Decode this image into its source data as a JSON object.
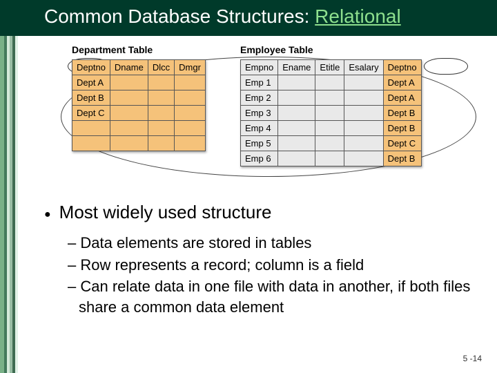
{
  "title": {
    "prefix": "Common Database Structures: ",
    "highlight": "Relational"
  },
  "diagram": {
    "dept": {
      "label": "Department Table",
      "headers": [
        "Deptno",
        "Dname",
        "Dlcc",
        "Dmgr"
      ],
      "rows": [
        [
          "Dept A",
          "",
          "",
          ""
        ],
        [
          "Dept B",
          "",
          "",
          ""
        ],
        [
          "Dept C",
          "",
          "",
          ""
        ],
        [
          "",
          "",
          "",
          ""
        ],
        [
          "",
          "",
          "",
          ""
        ]
      ]
    },
    "emp": {
      "label": "Employee Table",
      "headers": [
        "Empno",
        "Ename",
        "Etitle",
        "Esalary",
        "Deptno"
      ],
      "rows": [
        [
          "Emp 1",
          "",
          "",
          "",
          "Dept A"
        ],
        [
          "Emp 2",
          "",
          "",
          "",
          "Dept A"
        ],
        [
          "Emp 3",
          "",
          "",
          "",
          "Dept B"
        ],
        [
          "Emp 4",
          "",
          "",
          "",
          "Dept B"
        ],
        [
          "Emp 5",
          "",
          "",
          "",
          "Dept C"
        ],
        [
          "Emp 6",
          "",
          "",
          "",
          "Dept B"
        ]
      ]
    }
  },
  "bullets": {
    "main": "Most widely used structure",
    "subs": [
      "Data elements are stored in tables",
      "Row represents a record; column is a field",
      "Can relate data in one file with data in another, if both files share a common data element"
    ]
  },
  "pagenum": "5 -14"
}
